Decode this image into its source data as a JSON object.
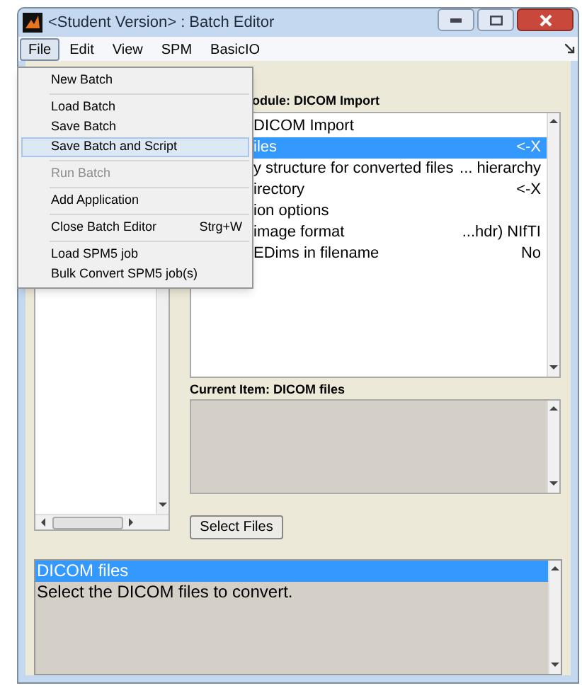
{
  "window": {
    "title": "<Student Version> : Batch Editor"
  },
  "menubar": [
    {
      "label": "File",
      "selected": true
    },
    {
      "label": "Edit",
      "selected": false
    },
    {
      "label": "View",
      "selected": false
    },
    {
      "label": "SPM",
      "selected": false
    },
    {
      "label": "BasicIO",
      "selected": false
    }
  ],
  "file_menu": [
    {
      "label": "New Batch",
      "disabled": false,
      "selected": false,
      "separator_before": false
    },
    {
      "label": "Load Batch",
      "disabled": false,
      "selected": false,
      "separator_before": true
    },
    {
      "label": "Save Batch",
      "disabled": false,
      "selected": false,
      "separator_before": false
    },
    {
      "label": "Save Batch and Script",
      "disabled": false,
      "selected": true,
      "separator_before": false
    },
    {
      "label": "Run Batch",
      "disabled": true,
      "selected": false,
      "separator_before": true
    },
    {
      "label": "Add Application",
      "disabled": false,
      "selected": false,
      "separator_before": true
    },
    {
      "label": "Close Batch Editor",
      "shortcut": "Strg+W",
      "disabled": false,
      "selected": false,
      "separator_before": true
    },
    {
      "label": "Load SPM5 job",
      "disabled": false,
      "selected": false,
      "separator_before": true
    },
    {
      "label": "Bulk Convert SPM5 job(s)",
      "disabled": false,
      "selected": false,
      "separator_before": false
    }
  ],
  "module": {
    "label": "odule: DICOM Import",
    "items": [
      {
        "name": "DICOM Import",
        "selected": false
      },
      {
        "name": "iles",
        "value": "<-X",
        "selected": true
      },
      {
        "name": "y structure for converted files",
        "value": "... hierarchy",
        "selected": false
      },
      {
        "name": "irectory",
        "value": "<-X",
        "selected": false
      },
      {
        "name": "ion options",
        "selected": false
      },
      {
        "name": "image format",
        "value": "...hdr) NIfTI",
        "selected": false
      },
      {
        "name": "EDims in filename",
        "value": "No",
        "selected": false
      }
    ]
  },
  "current_item": {
    "label": "Current Item: DICOM files"
  },
  "select_button": "Select Files",
  "help": {
    "items": [
      {
        "text": "DICOM files",
        "selected": true
      },
      {
        "text": "Select the DICOM files to convert.",
        "selected": false
      }
    ]
  }
}
